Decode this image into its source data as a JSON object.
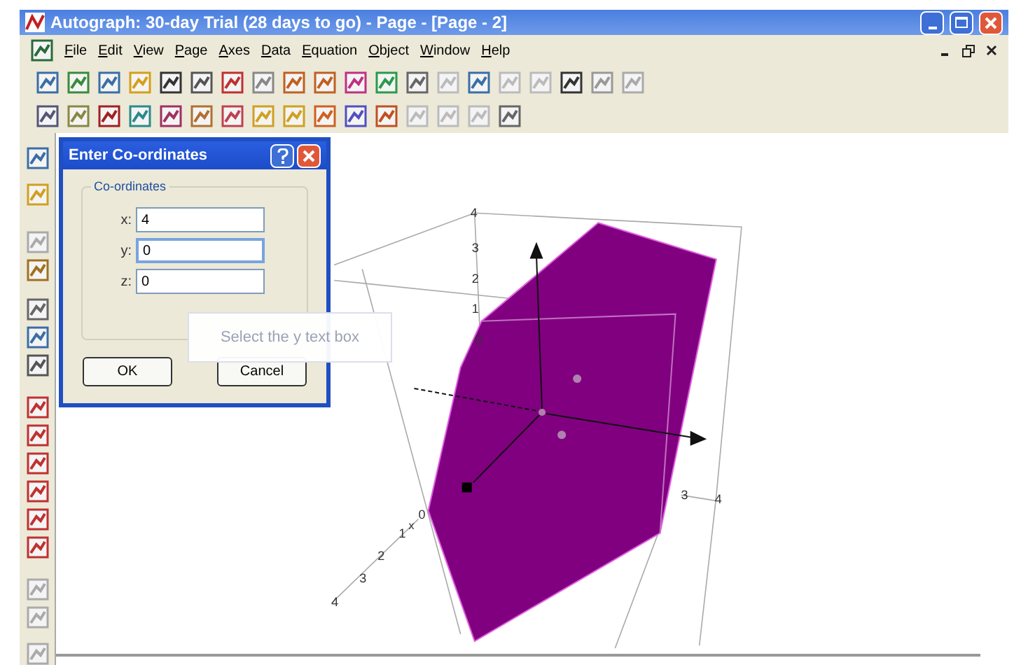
{
  "window": {
    "title": "Autograph: 30-day Trial (28 days to go) - Page - [Page - 2]",
    "menu": [
      "File",
      "Edit",
      "View",
      "Page",
      "Axes",
      "Data",
      "Equation",
      "Object",
      "Window",
      "Help"
    ]
  },
  "dialog": {
    "title": "Enter Co-ordinates",
    "group": "Co-ordinates",
    "fields": [
      {
        "label": "x:",
        "value": "4",
        "focused": false
      },
      {
        "label": "y:",
        "value": "0",
        "focused": true
      },
      {
        "label": "z:",
        "value": "0",
        "focused": false
      }
    ],
    "buttons": [
      "OK",
      "Cancel"
    ]
  },
  "tooltip": "Select the y text box",
  "plot": {
    "z_ticks": [
      "4",
      "3",
      "2",
      "1",
      "0"
    ],
    "x_ticks": [
      "0",
      "1",
      "2",
      "3",
      "4"
    ],
    "x_axis_label": "x",
    "y_ticks": [
      "3",
      "4"
    ]
  }
}
